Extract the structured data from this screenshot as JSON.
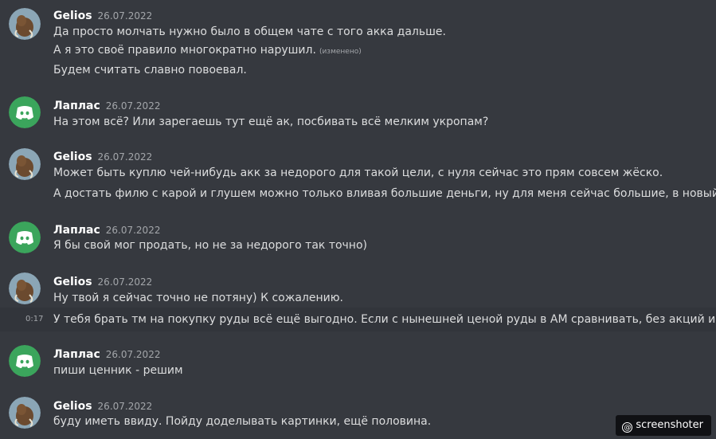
{
  "colors": {
    "background": "#36393f",
    "author": "#ffffff",
    "text": "#dcddde",
    "timestamp": "#a3a6aa",
    "discord_green": "#3ba55c"
  },
  "messages": [
    {
      "author": "Gelios",
      "date": "26.07.2022",
      "avatar": "mammoth-avatar",
      "lines": [
        {
          "text": "Да просто молчать нужно было в общем чате с того акка дальше."
        },
        {
          "text": "А я это своё правило многократно нарушил.",
          "edited": "(изменено)"
        },
        {
          "text": "Будем считать славно повоевал."
        }
      ]
    },
    {
      "author": "Лаплас",
      "date": "26.07.2022",
      "avatar": "discord-avatar",
      "lines": [
        {
          "text": "На этом всё? Или зарегаешь тут ещё ак, посбивать всё мелким укропам?"
        }
      ]
    },
    {
      "author": "Gelios",
      "date": "26.07.2022",
      "avatar": "mammoth-avatar",
      "lines": [
        {
          "text": "Может быть куплю чей-нибудь акк за недорого для такой цели, с нуля сейчас это прям совсем жёско."
        },
        {
          "text": "А достать филю с карой и глушем можно только вливая большие деньги, ну для меня сейчас большие, в новый акк."
        }
      ]
    },
    {
      "author": "Лаплас",
      "date": "26.07.2022",
      "avatar": "discord-avatar",
      "lines": [
        {
          "text": "Я бы свой мог продать, но не за недорого так точно)"
        }
      ]
    },
    {
      "author": "Gelios",
      "date": "26.07.2022",
      "avatar": "mammoth-avatar",
      "lines": [
        {
          "text": "Ну твой я сейчас точно не потяну) К сожалению."
        },
        {
          "text": "У тебя брать тм на покупку руды всё ещё выгодно. Если с нынешней ценой руды в АМ сравнивать, без акций и спец.",
          "side_time": "0:17"
        }
      ]
    },
    {
      "author": "Лаплас",
      "date": "26.07.2022",
      "avatar": "discord-avatar",
      "lines": [
        {
          "text": "пиши ценник - решим"
        }
      ]
    },
    {
      "author": "Gelios",
      "date": "26.07.2022",
      "avatar": "mammoth-avatar",
      "lines": [
        {
          "text": "буду иметь ввиду. Пойду доделывать картинки, ещё половина."
        }
      ]
    }
  ],
  "watermark": {
    "icon": "at-icon",
    "text": "screenshoter"
  }
}
